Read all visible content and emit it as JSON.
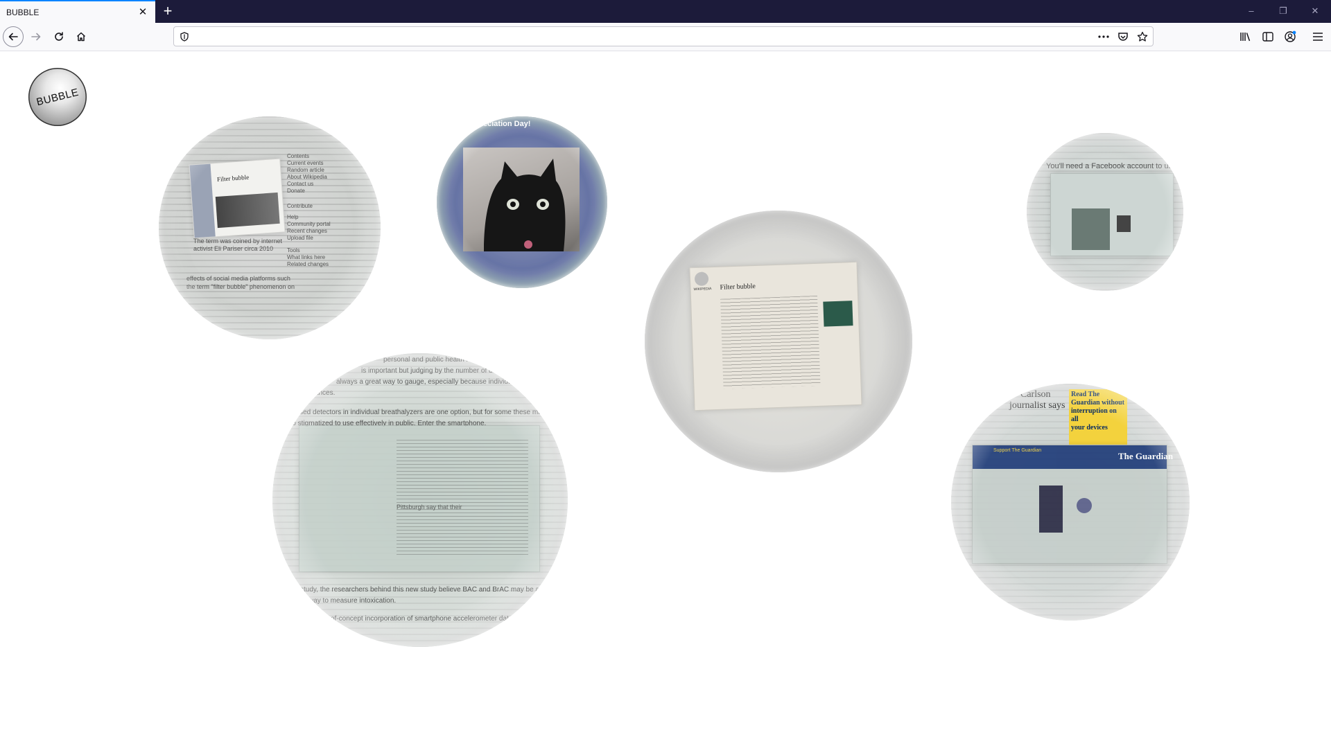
{
  "browser": {
    "tab_title": "BUBBLE",
    "tab_close_glyph": "✕",
    "new_tab_glyph": "+",
    "url_value": "",
    "icons": {
      "back": "back-arrow-icon",
      "forward": "forward-arrow-icon",
      "reload": "reload-icon",
      "home": "home-icon",
      "site_info": "shield-icon",
      "page_actions": "more-dots-icon",
      "pocket": "pocket-icon",
      "bookmark": "star-icon",
      "library": "library-icon",
      "sidebar": "sidebar-icon",
      "account": "account-icon",
      "menu": "hamburger-menu-icon",
      "minimize": "minimize-icon",
      "restore": "restore-icon",
      "close": "close-window-icon"
    },
    "window_controls": {
      "minimize": "–",
      "restore": "❐",
      "close": "✕"
    },
    "accent_color": "#0a84ff"
  },
  "page": {
    "logo_text": "BUBBLE",
    "bubbles": [
      {
        "name": "wikipedia-filter-bubble",
        "card_title": "Filter bubble",
        "over_text": [
          "Contents",
          "Current events",
          "Random article",
          "About Wikipedia",
          "Contact us",
          "Donate",
          "Contribute",
          "Help",
          "Community portal",
          "Recent changes",
          "Upload file",
          "Tools",
          "What links here",
          "Related changes",
          "The term was coined by internet",
          "activist Eli Pariser circa 2010",
          "effects of social media platforms such",
          "the term \"filter bubble\" phenomenon on"
        ]
      },
      {
        "name": "cat-appreciation",
        "over_text": [
          "preciation Day!"
        ]
      },
      {
        "name": "wikipedia-filter-bubble-large",
        "card_title": "Filter bubble",
        "card_site": "WIKIPEDIA"
      },
      {
        "name": "facebook-bubble",
        "over_text": [
          "You'll need a Facebook account to use"
        ]
      },
      {
        "name": "breathalyzer-study",
        "over_text": [
          "personal and public health risk a",
          "is important but judging by the number of drinks",
          "always a great way to gauge, especially because individuals have",
          "erances.",
          "based detectors in individual breathalyzers are one option, but for some these may be",
          "too stigmatized to use effectively in public. Enter the smartphone.",
          "Pittsburgh say that their",
          "study, the researchers behind this new study believe BAC and BrAC may be a more accurate",
          "way to measure intoxication.",
          "of-concept incorporation of smartphone accelerometer data has the potential to"
        ]
      },
      {
        "name": "guardian-bubble",
        "over_text": [
          "Carlson",
          "journalist says",
          "Read The",
          "Guardian without",
          "interruption on all",
          "your devices",
          "Support The Guardian",
          "The Guardian"
        ]
      }
    ]
  }
}
